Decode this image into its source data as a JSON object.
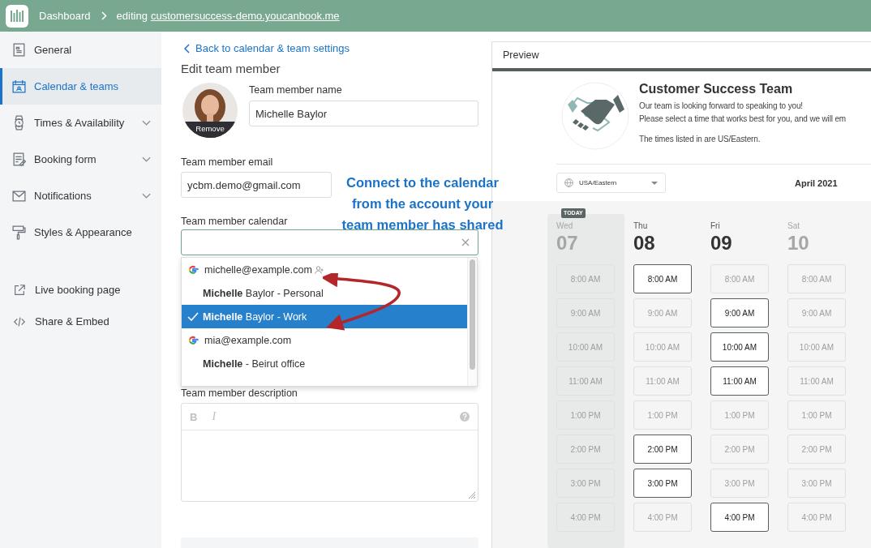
{
  "top_bar": {
    "breadcrumb": "Dashboard",
    "editing_prefix": "editing",
    "site_link": "customersuccess-demo.youcanbook.me"
  },
  "sidebar": {
    "items": [
      {
        "label": "General",
        "selected": false,
        "expandable": false
      },
      {
        "label": "Calendar & teams",
        "selected": true,
        "expandable": false
      },
      {
        "label": "Times & Availability",
        "selected": false,
        "expandable": true
      },
      {
        "label": "Booking form",
        "selected": false,
        "expandable": true
      },
      {
        "label": "Notifications",
        "selected": false,
        "expandable": true
      },
      {
        "label": "Styles & Appearance",
        "selected": false,
        "expandable": false
      }
    ],
    "links": [
      {
        "label": "Live booking page"
      },
      {
        "label": "Share & Embed"
      }
    ]
  },
  "form": {
    "back_link": "Back to calendar & team settings",
    "heading": "Edit team member",
    "avatar_action": "Remove",
    "name_label": "Team member name",
    "name_value": "Michelle Baylor",
    "email_label": "Team member email",
    "email_value": "ycbm.demo@gmail.com",
    "calendar_label": "Team member calendar",
    "calendar_options": [
      {
        "kind": "account",
        "label": "michelle@example.com",
        "shared": true,
        "selected": false
      },
      {
        "kind": "calendar",
        "label": "**Michelle** Baylor - Personal",
        "selected": false
      },
      {
        "kind": "calendar",
        "label": "**Michelle** Baylor - Work",
        "selected": true
      },
      {
        "kind": "account",
        "label": "mia@example.com",
        "shared": false,
        "selected": false
      },
      {
        "kind": "calendar",
        "label": "**Michelle** - Beirut office",
        "selected": false
      }
    ],
    "description_label": "Team member description",
    "editor_tools": [
      "B",
      "I"
    ]
  },
  "annotation": {
    "lines": [
      "Connect to the calendar",
      "from the account your",
      "team member has shared"
    ]
  },
  "preview": {
    "title": "Preview",
    "team_name": "Customer Success Team",
    "intro_lines": [
      "Our team is looking forward to speaking to you!",
      "Please select a time that works best for you, and we will em"
    ],
    "timezone_note": "The times listed in are US/Eastern.",
    "timezone": "USA/Eastern",
    "month": "April 2021",
    "today_badge": "TODAY",
    "days": [
      {
        "weekday": "Wed",
        "date": "07",
        "today": true,
        "disabled": true,
        "slots": [
          {
            "time": "8:00 AM",
            "available": false
          },
          {
            "time": "9:00 AM",
            "available": false
          },
          {
            "time": "10:00 AM",
            "available": false
          },
          {
            "time": "11:00 AM",
            "available": false
          },
          {
            "time": "1:00 PM",
            "available": false
          },
          {
            "time": "2:00 PM",
            "available": false
          },
          {
            "time": "3:00 PM",
            "available": false
          },
          {
            "time": "4:00 PM",
            "available": false
          }
        ]
      },
      {
        "weekday": "Thu",
        "date": "08",
        "today": false,
        "disabled": false,
        "slots": [
          {
            "time": "8:00 AM",
            "available": true
          },
          {
            "time": "9:00 AM",
            "available": false
          },
          {
            "time": "10:00 AM",
            "available": false
          },
          {
            "time": "11:00 AM",
            "available": false
          },
          {
            "time": "1:00 PM",
            "available": false
          },
          {
            "time": "2:00 PM",
            "available": true
          },
          {
            "time": "3:00 PM",
            "available": true
          },
          {
            "time": "4:00 PM",
            "available": false
          }
        ]
      },
      {
        "weekday": "Fri",
        "date": "09",
        "today": false,
        "disabled": false,
        "slots": [
          {
            "time": "8:00 AM",
            "available": false
          },
          {
            "time": "9:00 AM",
            "available": true
          },
          {
            "time": "10:00 AM",
            "available": true
          },
          {
            "time": "11:00 AM",
            "available": true
          },
          {
            "time": "1:00 PM",
            "available": false
          },
          {
            "time": "2:00 PM",
            "available": false
          },
          {
            "time": "3:00 PM",
            "available": false
          },
          {
            "time": "4:00 PM",
            "available": true
          }
        ]
      },
      {
        "weekday": "Sat",
        "date": "10",
        "today": false,
        "disabled": true,
        "slots": [
          {
            "time": "8:00 AM",
            "available": false
          },
          {
            "time": "9:00 AM",
            "available": false
          },
          {
            "time": "10:00 AM",
            "available": false
          },
          {
            "time": "11:00 AM",
            "available": false
          },
          {
            "time": "1:00 PM",
            "available": false
          },
          {
            "time": "2:00 PM",
            "available": false
          },
          {
            "time": "3:00 PM",
            "available": false
          },
          {
            "time": "4:00 PM",
            "available": false
          }
        ]
      }
    ]
  }
}
